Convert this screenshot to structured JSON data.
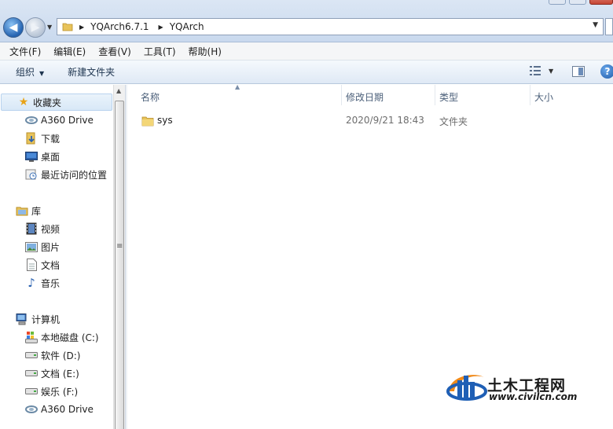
{
  "address_bar": {
    "path": [
      "YQArch6.7.1",
      "YQArch"
    ]
  },
  "menu": [
    "文件(F)",
    "编辑(E)",
    "查看(V)",
    "工具(T)",
    "帮助(H)"
  ],
  "toolbar": {
    "organize_label": "组织",
    "new_folder_label": "新建文件夹",
    "help_label": "?"
  },
  "nav": {
    "favorites_label": "收藏夹",
    "favorites": [
      "A360 Drive",
      "下载",
      "桌面",
      "最近访问的位置"
    ],
    "libraries_label": "库",
    "libraries": [
      "视频",
      "图片",
      "文档",
      "音乐"
    ],
    "computer_label": "计算机",
    "drives": [
      "本地磁盘 (C:)",
      "软件 (D:)",
      "文档 (E:)",
      "娱乐 (F:)",
      "A360 Drive"
    ]
  },
  "columns": {
    "name": "名称",
    "date": "修改日期",
    "type": "类型",
    "size": "大小"
  },
  "files": [
    {
      "name": "sys",
      "date": "2020/9/21 18:43",
      "type": "文件夹",
      "size": ""
    }
  ],
  "watermark": {
    "title": "土木工程网",
    "url": "www.civilcn.com"
  },
  "colors": {
    "folder": "#e8c35a",
    "accent": "#1f5aa8",
    "logo_orange": "#f08a1a",
    "logo_blue": "#1f5fb5"
  }
}
